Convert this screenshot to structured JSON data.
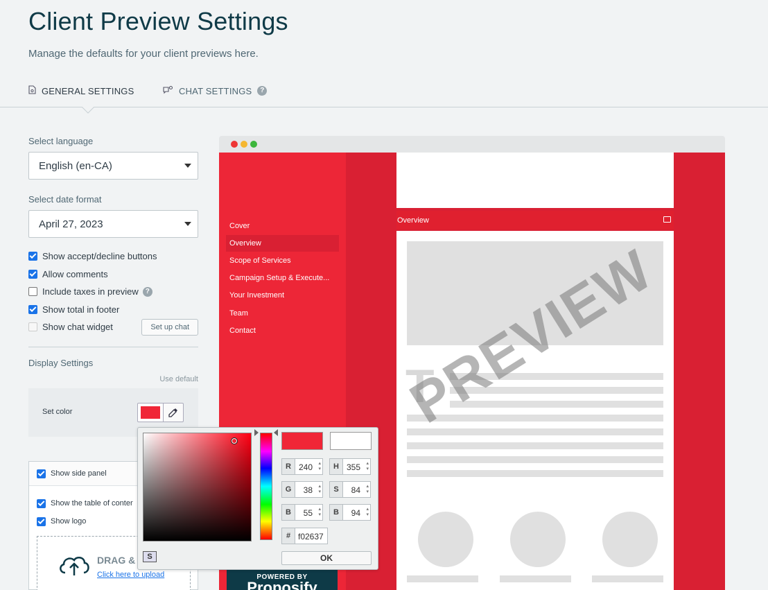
{
  "header": {
    "title": "Client Preview Settings",
    "subtitle": "Manage the defaults for your client previews here."
  },
  "tabs": [
    {
      "label": "GENERAL SETTINGS",
      "icon": "document-gear-icon",
      "active": true
    },
    {
      "label": "CHAT SETTINGS",
      "icon": "chat-gear-icon",
      "active": false
    }
  ],
  "settings": {
    "language_label": "Select language",
    "language_value": "English (en-CA)",
    "date_label": "Select date format",
    "date_value": "April 27, 2023",
    "checks": [
      {
        "label": "Show accept/decline buttons",
        "checked": true
      },
      {
        "label": "Allow comments",
        "checked": true
      },
      {
        "label": "Include taxes in preview",
        "checked": false
      },
      {
        "label": "Show total in footer",
        "checked": true
      },
      {
        "label": "Show chat widget",
        "checked": false,
        "disabled": true
      }
    ],
    "setup_chat_label": "Set up chat",
    "display_title": "Display Settings",
    "use_default": "Use default",
    "set_color_label": "Set color",
    "color": "#f02637"
  },
  "side_panel": {
    "show_side_panel": "Show side panel",
    "show_toc": "Show the table of conter",
    "show_logo": "Show logo",
    "drag_text": "DRAG &",
    "upload_link": "Click here to upload"
  },
  "preview": {
    "nav": [
      "Cover",
      "Overview",
      "Scope of Services",
      "Campaign Setup & Execute...",
      "Your Investment",
      "Team",
      "Contact"
    ],
    "active_nav": "Overview",
    "section_title": "Overview",
    "placeholder_letter": "T",
    "watermark": "PREVIEW",
    "powered_by": "POWERED BY",
    "brand": "Proposify",
    "sidebar_color": "#ed2637",
    "accent_color": "#d92033"
  },
  "picker": {
    "r": {
      "k": "R",
      "v": "240"
    },
    "g": {
      "k": "G",
      "v": "38"
    },
    "b": {
      "k": "B",
      "v": "55"
    },
    "h": {
      "k": "H",
      "v": "355"
    },
    "s": {
      "k": "S",
      "v": "84"
    },
    "bv": {
      "k": "B",
      "v": "94"
    },
    "hex_key": "#",
    "hex": "f02637",
    "s_button": "S",
    "ok": "OK"
  }
}
